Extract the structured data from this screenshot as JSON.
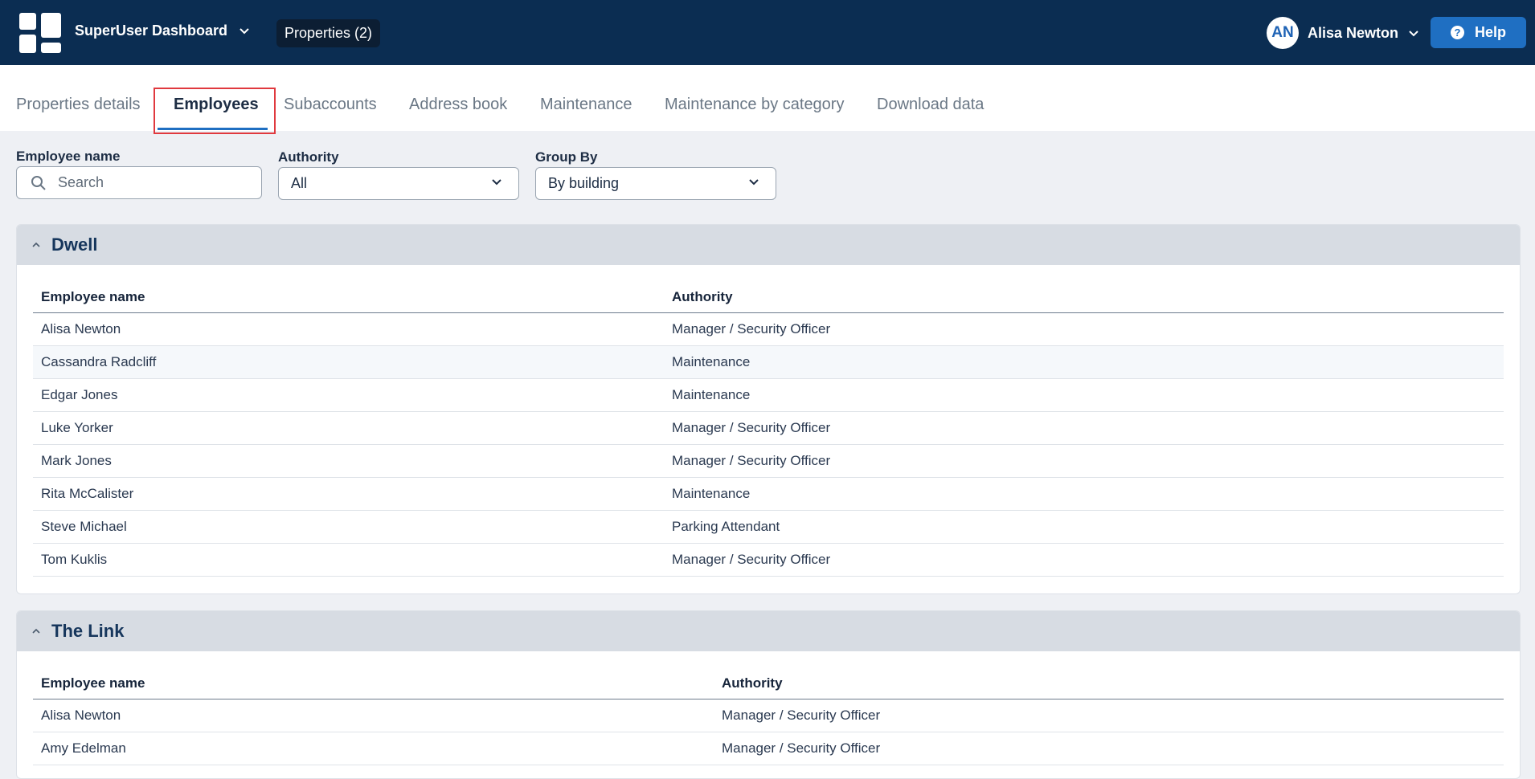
{
  "header": {
    "app_title": "SuperUser Dashboard",
    "properties_label": "Properties (2)",
    "user_initials": "AN",
    "user_name": "Alisa Newton",
    "help_label": "Help",
    "help_icon_glyph": "?",
    "colors": {
      "navbar": "#0b2d52",
      "accent": "#1f6fc2"
    }
  },
  "tabs": [
    {
      "label": "Properties details"
    },
    {
      "label": "Employees",
      "active": true
    },
    {
      "label": "Subaccounts"
    },
    {
      "label": "Address book"
    },
    {
      "label": "Maintenance"
    },
    {
      "label": "Maintenance by category"
    },
    {
      "label": "Download data"
    }
  ],
  "filters": {
    "employee_name": {
      "label": "Employee name",
      "placeholder": "Search",
      "value": ""
    },
    "authority": {
      "label": "Authority",
      "value": "All"
    },
    "group_by": {
      "label": "Group By",
      "value": "By building"
    }
  },
  "groups": [
    {
      "title": "Dwell",
      "columns": [
        "Employee name",
        "Authority"
      ],
      "rows": [
        {
          "name": "Alisa Newton",
          "authority": "Manager / Security Officer"
        },
        {
          "name": "Cassandra Radcliff",
          "authority": "Maintenance"
        },
        {
          "name": "Edgar Jones",
          "authority": "Maintenance"
        },
        {
          "name": "Luke Yorker",
          "authority": "Manager / Security Officer"
        },
        {
          "name": "Mark Jones",
          "authority": "Manager / Security Officer"
        },
        {
          "name": "Rita McCalister",
          "authority": "Maintenance"
        },
        {
          "name": "Steve Michael",
          "authority": "Parking Attendant"
        },
        {
          "name": "Tom Kuklis",
          "authority": "Manager / Security Officer"
        }
      ]
    },
    {
      "title": "The Link",
      "columns": [
        "Employee name",
        "Authority"
      ],
      "rows": [
        {
          "name": "Alisa Newton",
          "authority": "Manager / Security Officer"
        },
        {
          "name": "Amy Edelman",
          "authority": "Manager / Security Officer"
        }
      ]
    }
  ]
}
